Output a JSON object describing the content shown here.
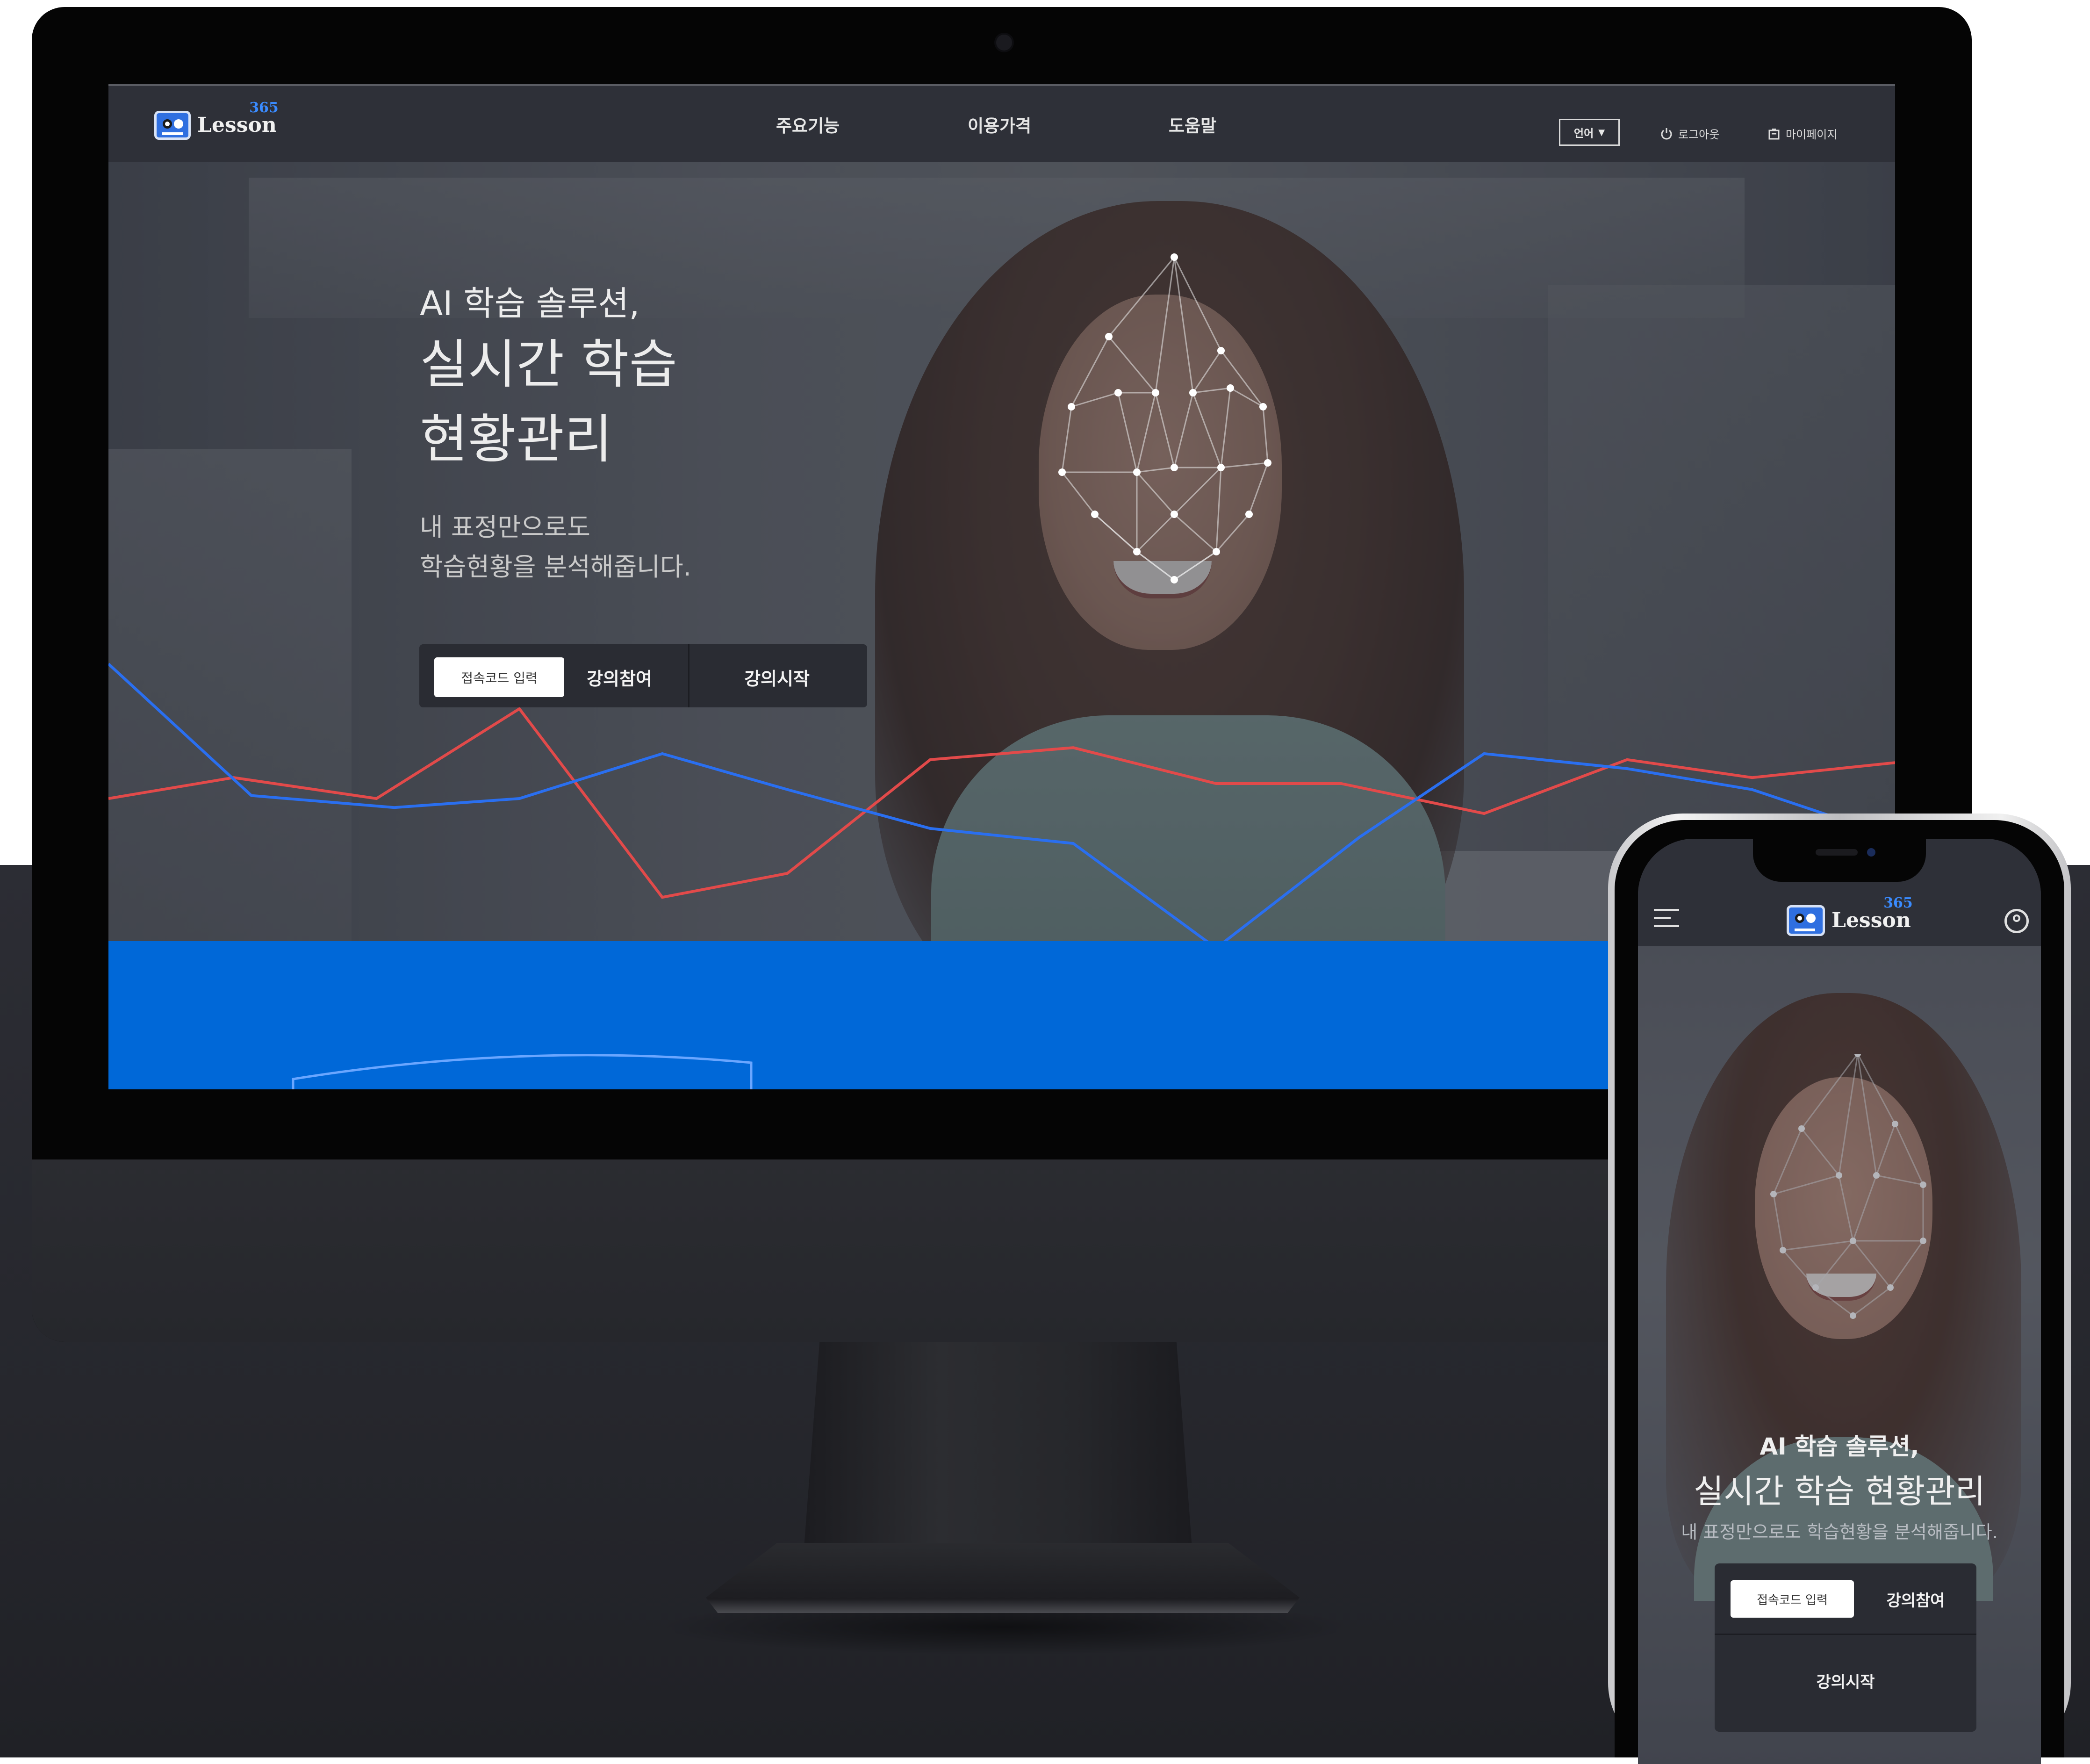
{
  "desktop": {
    "logo": {
      "word": "Lesson",
      "number": "365"
    },
    "nav": [
      {
        "label": "주요기능"
      },
      {
        "label": "이용가격"
      },
      {
        "label": "도움말"
      }
    ],
    "language_label": "언어",
    "logout_label": "로그아웃",
    "mypage_label": "마이페이지",
    "hero": {
      "subtitle": "AI 학습 솔루션,",
      "title_line1": "실시간 학습",
      "title_line2": "현황관리",
      "desc_line1": "내 표정만으로도",
      "desc_line2": "학습현황을 분석해줍니다."
    },
    "cta": {
      "input_placeholder": "접속코드 입력",
      "join_label": "강의참여",
      "start_label": "강의시작"
    }
  },
  "mobile": {
    "logo": {
      "word": "Lesson",
      "number": "365"
    },
    "hero": {
      "subtitle": "AI 학습 솔루션,",
      "title": "실시간 학습 현황관리",
      "desc": "내 표정만으로도 학습현황을 분석해줍니다."
    },
    "cta": {
      "input_placeholder": "접속코드 입력",
      "join_label": "강의참여",
      "start_label": "강의시작"
    }
  },
  "colors": {
    "accent_blue": "#0068d8",
    "graph_red": "#e24a4a",
    "graph_blue": "#2a6ff0",
    "navbar": "#2e3038"
  },
  "decorative_lines": {
    "red": [
      [
        0,
        0.45
      ],
      [
        0.07,
        0.38
      ],
      [
        0.15,
        0.45
      ],
      [
        0.23,
        0.15
      ],
      [
        0.31,
        0.78
      ],
      [
        0.38,
        0.7
      ],
      [
        0.46,
        0.32
      ],
      [
        0.54,
        0.28
      ],
      [
        0.62,
        0.4
      ],
      [
        0.69,
        0.4
      ],
      [
        0.77,
        0.5
      ],
      [
        0.85,
        0.32
      ],
      [
        0.92,
        0.38
      ],
      [
        1,
        0.33
      ]
    ],
    "blue": [
      [
        0,
        0
      ],
      [
        0.08,
        0.44
      ],
      [
        0.16,
        0.48
      ],
      [
        0.23,
        0.45
      ],
      [
        0.31,
        0.3
      ],
      [
        0.38,
        0.42
      ],
      [
        0.46,
        0.55
      ],
      [
        0.54,
        0.6
      ],
      [
        0.62,
        0.95
      ],
      [
        0.7,
        0.58
      ],
      [
        0.77,
        0.3
      ],
      [
        0.85,
        0.35
      ],
      [
        0.92,
        0.42
      ],
      [
        1,
        0.58
      ]
    ]
  },
  "icons": {
    "language_caret": "caret-down-icon",
    "logout": "power-icon",
    "mypage": "building-icon",
    "menu": "hamburger-icon",
    "profile": "user-icon"
  }
}
